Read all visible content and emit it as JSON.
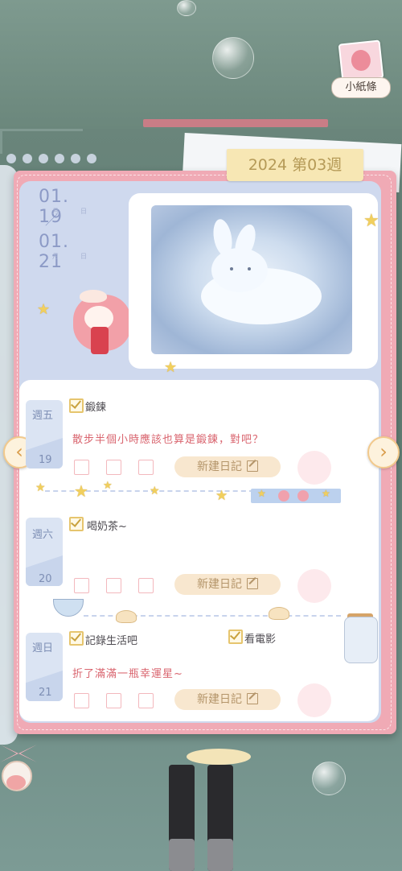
{
  "header": {
    "week_label": "2024 第03週"
  },
  "date_range": {
    "start": {
      "date": "01. 19",
      "month_unit": "月",
      "day_unit": "日"
    },
    "separator": "／",
    "end": {
      "date": "01. 21",
      "month_unit": "月",
      "day_unit": "日"
    }
  },
  "side_widget": {
    "notes_label": "小紙條",
    "notes_icon": "note-portrait-icon"
  },
  "nav": {
    "prev_icon": "chevron-left",
    "next_icon": "chevron-right",
    "prev_glyph": "‹",
    "next_glyph": "›"
  },
  "days": [
    {
      "weekday": "週五",
      "day": "19",
      "todos": [
        {
          "label": "鍛鍊",
          "checked": true
        }
      ],
      "note": "散步半個小時應該也算是鍛鍊，對吧？",
      "new_entry_label": "新建日記"
    },
    {
      "weekday": "週六",
      "day": "20",
      "todos": [
        {
          "label": "喝奶茶~",
          "checked": true
        }
      ],
      "note": "",
      "new_entry_label": "新建日記"
    },
    {
      "weekday": "週日",
      "day": "21",
      "todos": [
        {
          "label": "記錄生活吧",
          "checked": true
        },
        {
          "label": "看電影",
          "checked": true
        }
      ],
      "note": "折了滿滿一瓶幸運星~",
      "new_entry_label": "新建日記"
    }
  ],
  "colors": {
    "accent_pink": "#f0aab5",
    "card_blue": "#cfd9ee",
    "note_red": "#d9646e",
    "button_bg": "#f8e7cf",
    "week_tag_bg": "#f7e7b4"
  }
}
